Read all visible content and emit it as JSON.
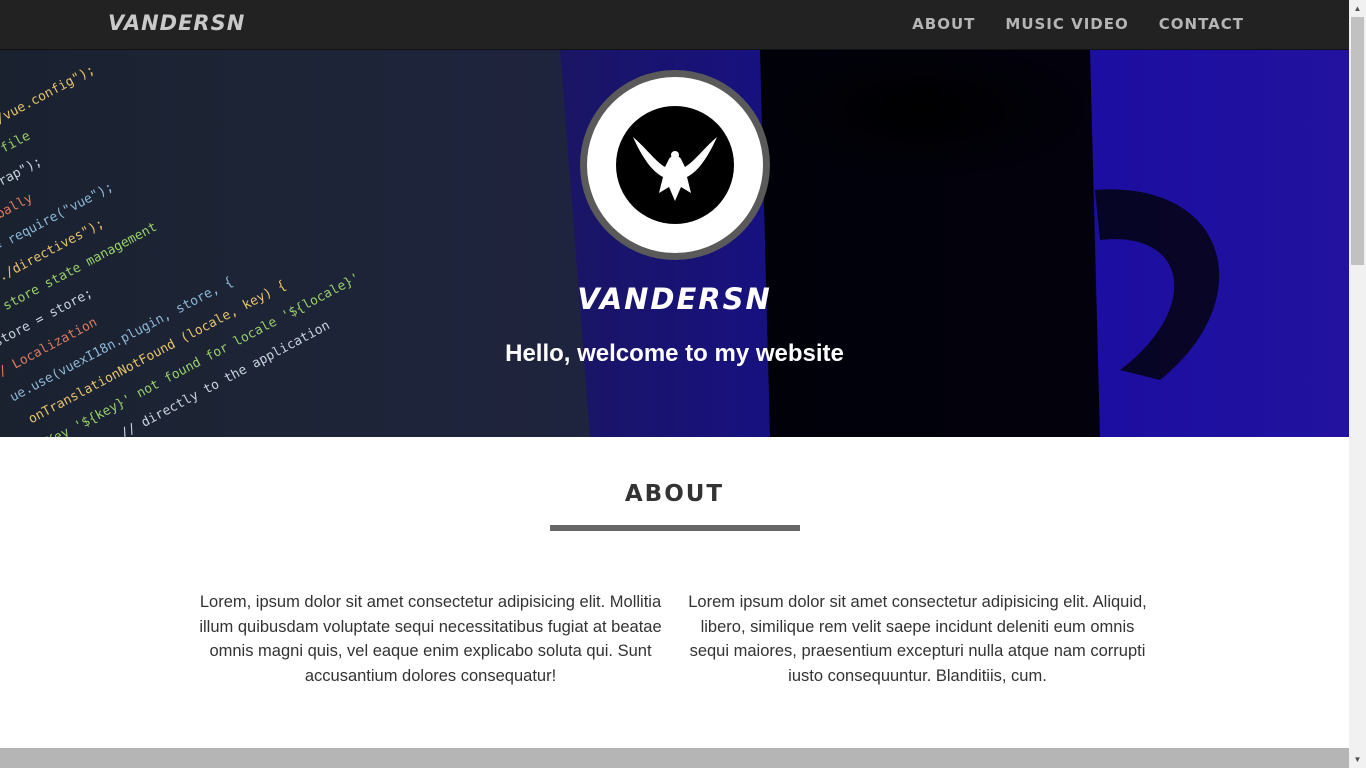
{
  "nav": {
    "brand": "VANDERSN",
    "links": [
      "ABOUT",
      "MUSIC VIDEO",
      "CONTACT"
    ]
  },
  "hero": {
    "title": "VANDERSN",
    "subtitle": "Hello, welcome to my website",
    "logo_icon": "eagle-icon",
    "code_lines": [
      "/config file into the",
      "re-config = require(\"./vue.config\");",
      "// Import bootstrap file",
      "require(\"./bootstrap\");",
      "// Set Vue globally",
      "window.Vue = require(\"vue\");",
      "require(\"./directives\");",
      "// Vue store state management",
      "ue.store = store;",
      "// Localization",
      "ue.use(vuexI18n.plugin, store, {",
      "onTranslationNotFound (locale, key) {",
      "Key '${key}' not found for locale '${locale}'",
      "return; // directly to the application"
    ]
  },
  "about": {
    "heading": "ABOUT",
    "left_text": "Lorem, ipsum dolor sit amet consectetur adipisicing elit. Mollitia illum quibusdam voluptate sequi necessitatibus fugiat at beatae omnis magni quis, vel eaque enim explicabo soluta qui. Sunt accusantium dolores consequatur!",
    "right_text": "Lorem ipsum dolor sit amet consectetur adipisicing elit. Aliquid, libero, similique rem velit saepe incidunt deleniti eum omnis sequi maiores, praesentium excepturi nulla atque nam corrupti iusto consequuntur. Blanditiis, cum."
  },
  "colors": {
    "navbar_bg": "#222222",
    "nav_text": "#b5b5b5",
    "hero_accent": "#1c0ea0",
    "rule": "#666666",
    "footer_strip": "#b5b5b5"
  },
  "scrollbar": {
    "up_icon": "chevron-up-icon",
    "down_icon": "chevron-down-icon"
  }
}
